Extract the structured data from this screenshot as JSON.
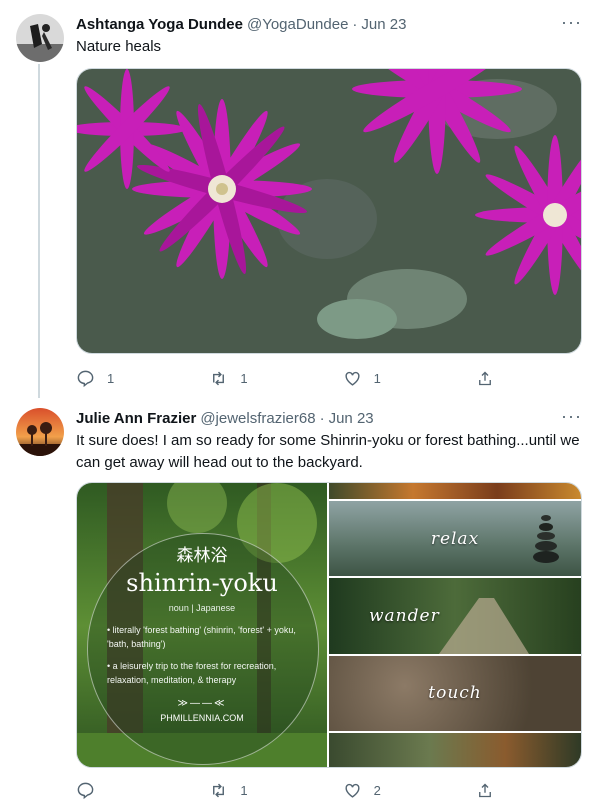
{
  "tweets": [
    {
      "name": "Ashtanga Yoga Dundee",
      "handle": "@YogaDundee",
      "separator": "·",
      "date": "Jun 23",
      "more": "···",
      "text": "Nature heals",
      "actions": {
        "reply": "1",
        "retweet": "1",
        "like": "1"
      }
    },
    {
      "name": "Julie Ann Frazier",
      "handle": "@jewelsfrazier68",
      "separator": "·",
      "date": "Jun 23",
      "more": "···",
      "text": "It sure does! I am so ready for some Shinrin-yoku or forest bathing...until we can get away will head out to the backyard.",
      "actions": {
        "reply": "",
        "retweet": "1",
        "like": "2"
      },
      "media": {
        "kanji": "森林浴",
        "title": "shinrin-yoku",
        "subtitle": "noun | Japanese",
        "definition_1": "• literally 'forest bathing' (shinrin, 'forest' + yoku, 'bath, bathing')",
        "definition_2": "• a leisurely trip to the forest for recreation, relaxation, meditation, & therapy",
        "url": "PHMILLENNIA.COM",
        "panels": [
          "relax",
          "wander",
          "touch"
        ]
      }
    }
  ],
  "icons": [
    "reply-icon",
    "retweet-icon",
    "like-icon",
    "share-icon"
  ],
  "colors": {
    "text": "#0f1419",
    "secondary": "#536471",
    "border": "#cfd9de",
    "flower": "#c81fb8"
  }
}
